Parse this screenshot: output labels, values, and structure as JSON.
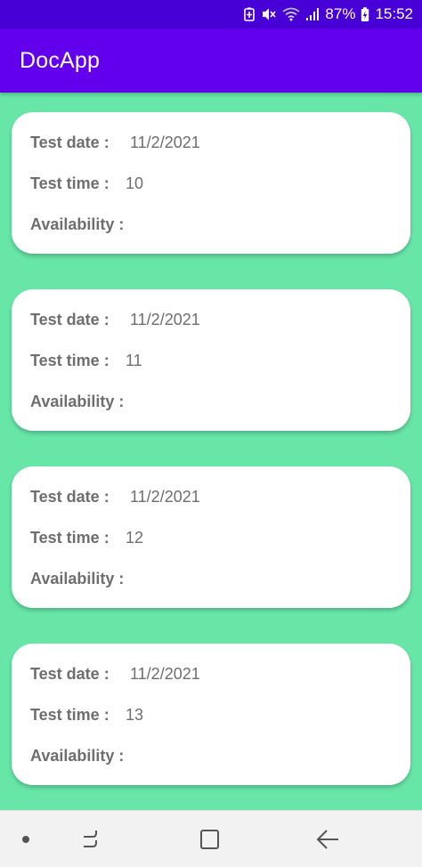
{
  "status_bar": {
    "battery_percent": "87%",
    "time": "15:52",
    "icons": [
      "battery-saver-icon",
      "mute-icon",
      "wifi-icon",
      "signal-icon",
      "battery-charging-icon"
    ]
  },
  "app_bar": {
    "title": "DocApp"
  },
  "cards": [
    {
      "date_label": "Test date :",
      "date_value": "11/2/2021",
      "time_label": "Test time :",
      "time_value": "10",
      "availability_label": "Availability :",
      "availability_value": ""
    },
    {
      "date_label": "Test date :",
      "date_value": "11/2/2021",
      "time_label": "Test time :",
      "time_value": "11",
      "availability_label": "Availability :",
      "availability_value": ""
    },
    {
      "date_label": "Test date :",
      "date_value": "11/2/2021",
      "time_label": "Test time :",
      "time_value": "12",
      "availability_label": "Availability :",
      "availability_value": ""
    },
    {
      "date_label": "Test date :",
      "date_value": "11/2/2021",
      "time_label": "Test time :",
      "time_value": "13",
      "availability_label": "Availability :",
      "availability_value": ""
    }
  ],
  "nav_bar": {
    "icons": [
      "dot-icon",
      "recents-icon",
      "home-icon",
      "back-icon"
    ]
  },
  "colors": {
    "status_bar": "#4700d6",
    "app_bar": "#6200ee",
    "background": "#68e6a8",
    "card": "#ffffff"
  }
}
